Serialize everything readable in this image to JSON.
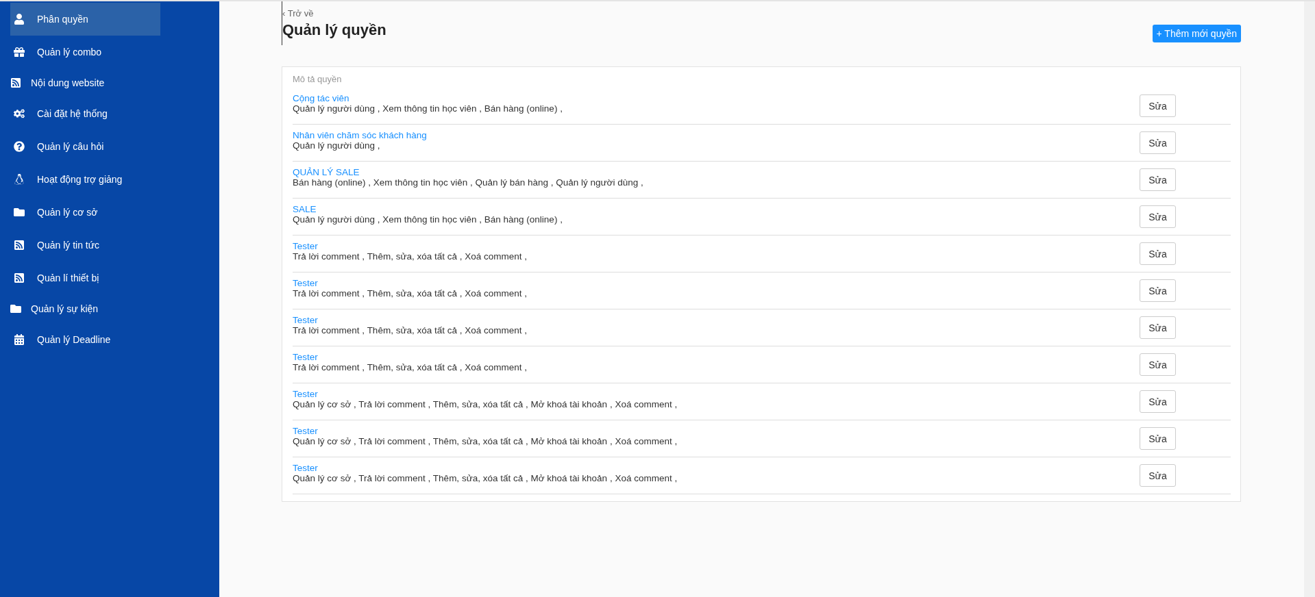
{
  "sidebar": {
    "items": [
      {
        "label": "Phân quyền",
        "selected": true,
        "compact": false
      },
      {
        "label": "Quản lý combo",
        "selected": false,
        "compact": false
      },
      {
        "label": "Nội dung website",
        "selected": false,
        "compact": true
      },
      {
        "label": "Cài đặt hệ thống",
        "selected": false,
        "compact": false
      },
      {
        "label": "Quản lý câu hỏi",
        "selected": false,
        "compact": false
      },
      {
        "label": "Hoạt động trợ giảng",
        "selected": false,
        "compact": false
      },
      {
        "label": "Quản lý cơ sở",
        "selected": false,
        "compact": false
      },
      {
        "label": "Quản lý tin tức",
        "selected": false,
        "compact": false
      },
      {
        "label": "Quản lí thiết bị",
        "selected": false,
        "compact": false
      },
      {
        "label": "Quản lý sự kiện",
        "selected": false,
        "compact": true
      },
      {
        "label": "Quản lý Deadline",
        "selected": false,
        "compact": false
      }
    ]
  },
  "header": {
    "back_link": "‹ Trở về",
    "title": "Quản lý quyền",
    "add_button": "+ Thêm mới quyền"
  },
  "table": {
    "column_header": "Mô tả quyền",
    "rows": [
      {
        "name": "Cộng tác viên",
        "permissions": "Quản lý người dùng , Xem thông tin học viên , Bán hàng (online) ,",
        "action": "Sửa"
      },
      {
        "name": "Nhân viên chăm sóc khách hàng",
        "permissions": "Quản lý người dùng ,",
        "action": "Sửa"
      },
      {
        "name": "QUẢN LÝ SALE",
        "permissions": "Bán hàng (online) , Xem thông tin học viên , Quản lý bán hàng , Quản lý người dùng ,",
        "action": "Sửa"
      },
      {
        "name": "SALE",
        "permissions": "Quản lý người dùng , Xem thông tin học viên , Bán hàng (online) ,",
        "action": "Sửa"
      },
      {
        "name": "Tester",
        "permissions": "Trả lời comment , Thêm, sửa, xóa tất cả , Xoá comment ,",
        "action": "Sửa"
      },
      {
        "name": "Tester",
        "permissions": "Trả lời comment , Thêm, sửa, xóa tất cả , Xoá comment ,",
        "action": "Sửa"
      },
      {
        "name": "Tester",
        "permissions": "Trả lời comment , Thêm, sửa, xóa tất cả , Xoá comment ,",
        "action": "Sửa"
      },
      {
        "name": "Tester",
        "permissions": "Trả lời comment , Thêm, sửa, xóa tất cả , Xoá comment ,",
        "action": "Sửa"
      },
      {
        "name": "Tester",
        "permissions": "Quản lý cơ sở , Trả lời comment , Thêm, sửa, xóa tất cả , Mở khoá tài khoản , Xoá comment ,",
        "action": "Sửa"
      },
      {
        "name": "Tester",
        "permissions": "Quản lý cơ sở , Trả lời comment , Thêm, sửa, xóa tất cả , Mở khoá tài khoản , Xoá comment ,",
        "action": "Sửa"
      },
      {
        "name": "Tester",
        "permissions": "Quản lý cơ sở , Trả lời comment , Thêm, sửa, xóa tất cả , Mở khoá tài khoản , Xoá comment ,",
        "action": "Sửa"
      }
    ]
  }
}
